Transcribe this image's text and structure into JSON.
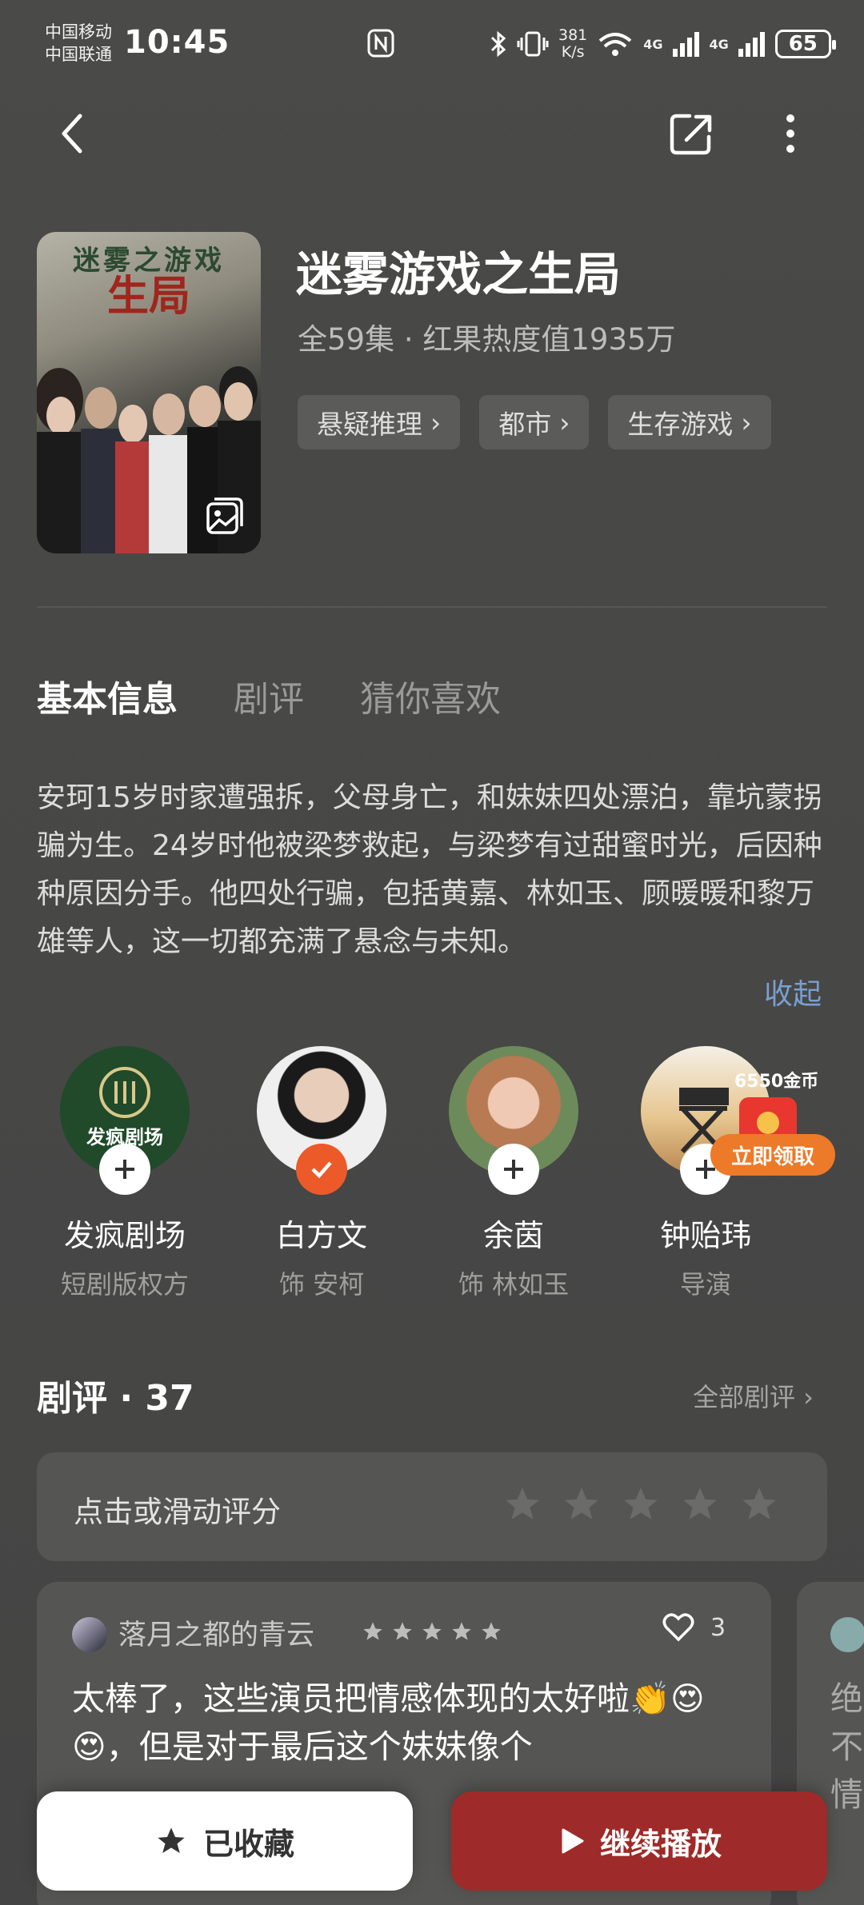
{
  "status_bar": {
    "carrier_1": "中国移动",
    "carrier_2": "中国联通",
    "time": "10:45",
    "net_speed_value": "381",
    "net_speed_unit": "K/s",
    "network_1": "4G",
    "network_2": "4G",
    "battery": "65",
    "icons": [
      "nfc-icon",
      "bluetooth-icon",
      "vibrate-icon",
      "wifi-icon",
      "signal-icon",
      "battery-icon"
    ]
  },
  "nav": {
    "icons": [
      "back-icon",
      "share-icon",
      "more-icon"
    ]
  },
  "drama": {
    "title": "迷雾游戏之生局",
    "meta": "全59集 · 红果热度值1935万",
    "tags": [
      {
        "label": "悬疑推理"
      },
      {
        "label": "都市"
      },
      {
        "label": "生存游戏"
      }
    ],
    "poster_title_top": "迷雾之游戏",
    "poster_title_main": "生局"
  },
  "tabs": [
    {
      "label": "基本信息",
      "active": true
    },
    {
      "label": "剧评",
      "active": false
    },
    {
      "label": "猜你喜欢",
      "active": false
    }
  ],
  "synopsis": "安珂15岁时家遭强拆，父母身亡，和妹妹四处漂泊，靠坑蒙拐骗为生。24岁时他被梁梦救起，与梁梦有过甜蜜时光，后因种种原因分手。他四处行骗，包括黄嘉、林如玉、顾暖暖和黎万雄等人，这一切都充满了悬念与未知。",
  "collapse_label": "收起",
  "cast": [
    {
      "name": "发疯剧场",
      "role": "短剧版权方",
      "followed": false,
      "logo_text": "发疯剧场"
    },
    {
      "name": "白方文",
      "role": "饰 安柯",
      "followed": true
    },
    {
      "name": "余茵",
      "role": "饰 林如玉",
      "followed": false
    },
    {
      "name": "钟贻玮",
      "role": "导演",
      "followed": false
    }
  ],
  "promo": {
    "coins": "6550金币",
    "button": "立即领取"
  },
  "reviews": {
    "heading": "剧评 · 37",
    "all_label": "全部剧评 ›",
    "rate_prompt": "点击或滑动评分",
    "items": [
      {
        "user": "落月之都的青云",
        "stars": 5,
        "likes": "3",
        "text": "太棒了，这些演员把情感体现的太好啦👏😍😍，但是对于最后这个妹妹像个"
      }
    ],
    "next_preview_text": "绝不情"
  },
  "bottom": {
    "favorite_label": "已收藏",
    "play_label": "继续播放"
  },
  "colors": {
    "accent_orange": "#ec7a28",
    "play_red": "#9e2b29",
    "link_blue": "#7a9fd1"
  }
}
